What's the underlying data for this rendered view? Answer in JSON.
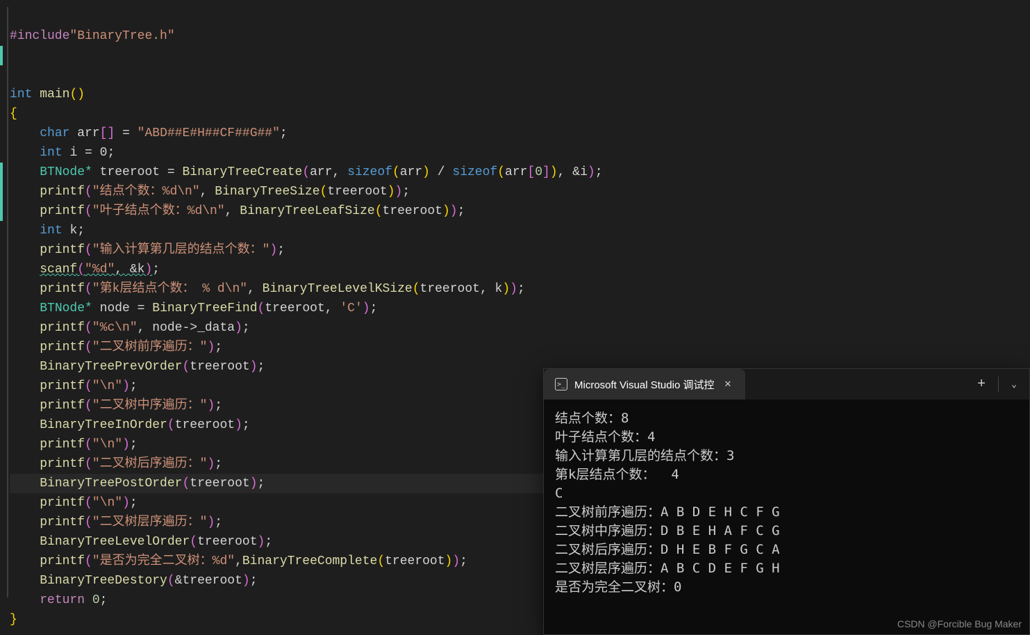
{
  "code": {
    "include_directive": "#include",
    "include_header": "\"BinaryTree.h\"",
    "main_sig": "int main()",
    "arr_decl_kw": "char",
    "arr_name": "arr",
    "arr_value": "\"ABD##E#H##CF##G##\"",
    "i_decl_kw": "int",
    "i_init": "i = 0;",
    "btnode_type": "BTNode*",
    "treeroot": "treeroot",
    "btc": "BinaryTreeCreate",
    "sizeof": "sizeof",
    "printf": "printf",
    "scanf": "scanf",
    "str_nodecount": "\"结点个数：%d\\n\"",
    "bt_size": "BinaryTreeSize",
    "str_leafcount": "\"叶子结点个数：%d\\n\"",
    "bt_leaf": "BinaryTreeLeafSize",
    "k_decl_kw": "int",
    "k_var": "k;",
    "str_input_level": "\"输入计算第几层的结点个数：\"",
    "scanf_fmt": "\"%d\"",
    "scanf_arg": "&k",
    "str_klevel": "\"第k层结点个数： % d\\n\"",
    "bt_levelk": "BinaryTreeLevelKSize",
    "node_var": "node",
    "bt_find": "BinaryTreeFind",
    "char_lit": "'C'",
    "str_charfmt": "\"%c\\n\"",
    "node_member": "node->_data",
    "str_preorder": "\"二叉树前序遍历：\"",
    "bt_prev": "BinaryTreePrevOrder",
    "str_nl": "\"\\n\"",
    "str_inorder": "\"二叉树中序遍历：\"",
    "bt_in": "BinaryTreeInOrder",
    "str_postorder": "\"二叉树后序遍历：\"",
    "bt_post": "BinaryTreePostOrder",
    "str_levelorder": "\"二叉树层序遍历：\"",
    "bt_level": "BinaryTreeLevelOrder",
    "str_complete": "\"是否为完全二叉树：%d\"",
    "bt_complete": "BinaryTreeComplete",
    "bt_destroy": "BinaryTreeDestory",
    "return_kw": "return",
    "return_val": "0"
  },
  "terminal": {
    "tab_title": "Microsoft Visual Studio 调试控",
    "lines": [
      "结点个数：8",
      "叶子结点个数：4",
      "输入计算第几层的结点个数：3",
      "第k层结点个数：  4",
      "C",
      "二叉树前序遍历：A B D E H C F G",
      "二叉树中序遍历：D B E H A F C G",
      "二叉树后序遍历：D H E B F G C A",
      "二叉树层序遍历：A B C D E F G H",
      "是否为完全二叉树：0"
    ]
  },
  "watermark": "CSDN @Forcible Bug Maker"
}
